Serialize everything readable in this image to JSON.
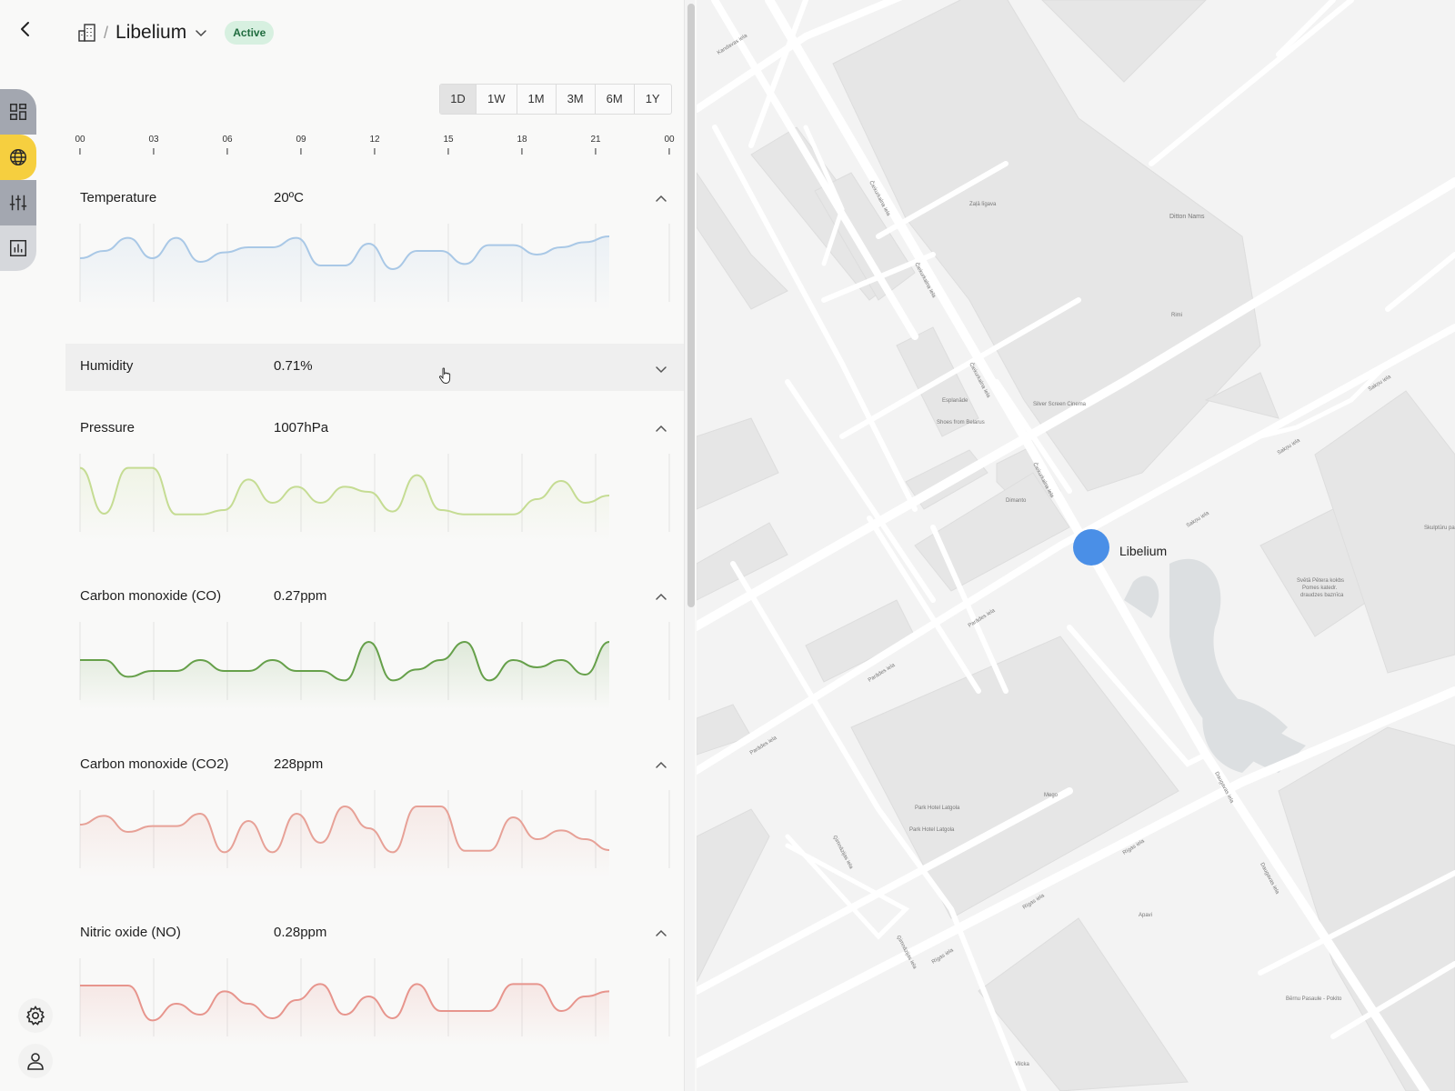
{
  "header": {
    "title": "Libelium",
    "separator": "/",
    "status_badge": "Active"
  },
  "range": {
    "options": [
      "1D",
      "1W",
      "1M",
      "3M",
      "6M",
      "1Y"
    ],
    "selected": "1D"
  },
  "time_axis": [
    "00",
    "03",
    "06",
    "09",
    "12",
    "15",
    "18",
    "21",
    "00"
  ],
  "metrics": [
    {
      "label": "Temperature",
      "value": "20ºC",
      "expanded": true,
      "color": "#a9c8e6"
    },
    {
      "label": "Humidity",
      "value": "0.71%",
      "expanded": false,
      "color": "#a9c8e6"
    },
    {
      "label": "Pressure",
      "value": "1007hPa",
      "expanded": true,
      "color": "#c5dc93"
    },
    {
      "label": "Carbon monoxide (CO)",
      "value": "0.27ppm",
      "expanded": true,
      "color": "#66a04a"
    },
    {
      "label": "Carbon monoxide (CO2)",
      "value": "228ppm",
      "expanded": true,
      "color": "#e7a197"
    },
    {
      "label": "Nitric oxide (NO)",
      "value": "0.28ppm",
      "expanded": true,
      "color": "#e7958d"
    }
  ],
  "chart_data": [
    {
      "type": "line",
      "name": "Temperature",
      "x": [
        "00",
        "01",
        "02",
        "03",
        "04",
        "05",
        "06",
        "07",
        "08",
        "09",
        "10",
        "11",
        "12",
        "13",
        "14",
        "15",
        "16",
        "17",
        "18",
        "19",
        "20",
        "21",
        "22"
      ],
      "values": [
        60,
        70,
        88,
        60,
        88,
        55,
        68,
        75,
        75,
        88,
        50,
        50,
        80,
        45,
        70,
        70,
        52,
        78,
        78,
        65,
        75,
        82,
        90
      ]
    },
    {
      "type": "line",
      "name": "Pressure",
      "x": [
        "00",
        "01",
        "02",
        "03",
        "04",
        "05",
        "06",
        "07",
        "08",
        "09",
        "10",
        "11",
        "12",
        "13",
        "14",
        "15",
        "16",
        "17",
        "18",
        "19",
        "20",
        "21",
        "22"
      ],
      "values": [
        88,
        25,
        88,
        88,
        24,
        24,
        30,
        72,
        40,
        62,
        40,
        62,
        55,
        28,
        78,
        30,
        24,
        24,
        24,
        45,
        70,
        40,
        50
      ]
    },
    {
      "type": "line",
      "name": "Carbon monoxide (CO)",
      "x": [
        "00",
        "01",
        "02",
        "03",
        "04",
        "05",
        "06",
        "07",
        "08",
        "09",
        "10",
        "11",
        "12",
        "13",
        "14",
        "15",
        "16",
        "17",
        "18",
        "19",
        "20",
        "21",
        "22"
      ],
      "values": [
        55,
        55,
        32,
        40,
        40,
        55,
        40,
        40,
        55,
        40,
        40,
        27,
        80,
        27,
        42,
        55,
        80,
        27,
        55,
        45,
        55,
        35,
        80
      ]
    },
    {
      "type": "line",
      "name": "Carbon monoxide (CO2)",
      "x": [
        "00",
        "01",
        "02",
        "03",
        "04",
        "05",
        "06",
        "07",
        "08",
        "09",
        "10",
        "11",
        "12",
        "13",
        "14",
        "15",
        "16",
        "17",
        "18",
        "19",
        "20",
        "21",
        "22"
      ],
      "values": [
        60,
        72,
        50,
        58,
        58,
        75,
        22,
        65,
        22,
        75,
        35,
        85,
        55,
        22,
        85,
        85,
        24,
        24,
        70,
        40,
        52,
        40,
        25
      ]
    },
    {
      "type": "line",
      "name": "Nitric oxide (NO)",
      "x": [
        "00",
        "01",
        "02",
        "03",
        "04",
        "05",
        "06",
        "07",
        "08",
        "09",
        "10",
        "11",
        "12",
        "13",
        "14",
        "15",
        "16",
        "17",
        "18",
        "19",
        "20",
        "21",
        "22"
      ],
      "values": [
        70,
        70,
        70,
        22,
        45,
        30,
        62,
        45,
        25,
        50,
        72,
        30,
        55,
        25,
        72,
        35,
        35,
        35,
        72,
        72,
        35,
        55,
        62
      ]
    }
  ],
  "map": {
    "location_label": "Libelium",
    "street_labels": [
      "Kandavas iela",
      "Dzirnavu iela",
      "Čiekurkalna iela",
      "Satiksmes iela",
      "Sakņu iela",
      "Parādes iela",
      "Rīgas iela",
      "Ģimnāzijas iela",
      "Daugavas iela"
    ],
    "poi_labels": [
      "Ditton Nams",
      "Rimi",
      "Silver Screen Cinema",
      "Esplanāde",
      "Shoes from Belarus",
      "Dimanto",
      "Park Hotel Latgola",
      "Mego",
      "Apavi",
      "Zaļā līgava",
      "Svētā Pētera kokbs",
      "Bērnu Pasaule - Pokito",
      "Skulptūru parks",
      "Vilcka"
    ]
  }
}
